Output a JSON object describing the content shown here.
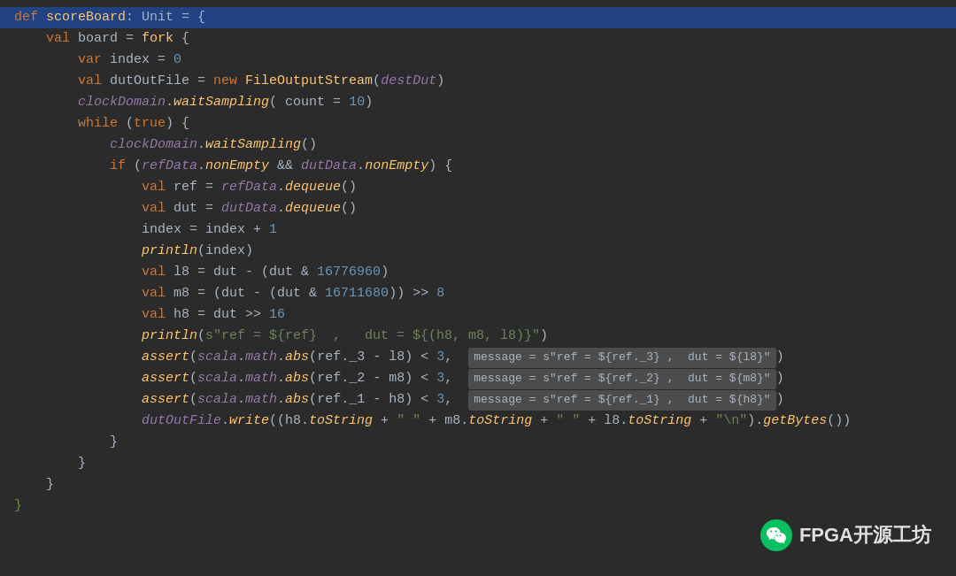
{
  "lines": [
    {
      "id": "line1",
      "indent": 0
    },
    {
      "id": "line2",
      "indent": 1
    },
    {
      "id": "line3",
      "indent": 2
    },
    {
      "id": "line4",
      "indent": 2
    },
    {
      "id": "line5",
      "indent": 2
    },
    {
      "id": "line6",
      "indent": 2
    },
    {
      "id": "line7",
      "indent": 3
    },
    {
      "id": "line8",
      "indent": 3
    },
    {
      "id": "line9",
      "indent": 4
    },
    {
      "id": "line10",
      "indent": 4
    },
    {
      "id": "line11",
      "indent": 4
    },
    {
      "id": "line12",
      "indent": 4
    },
    {
      "id": "line13",
      "indent": 4
    },
    {
      "id": "line14",
      "indent": 4
    },
    {
      "id": "line15",
      "indent": 4
    },
    {
      "id": "line16",
      "indent": 4
    },
    {
      "id": "line17",
      "indent": 4
    },
    {
      "id": "line18",
      "indent": 4
    },
    {
      "id": "line19",
      "indent": 4
    },
    {
      "id": "line20",
      "indent": 4
    },
    {
      "id": "line21",
      "indent": 3
    },
    {
      "id": "line22",
      "indent": 2
    },
    {
      "id": "line23",
      "indent": 1
    },
    {
      "id": "line24",
      "indent": 0
    }
  ],
  "branding": {
    "text": "FPGA开源工坊"
  }
}
